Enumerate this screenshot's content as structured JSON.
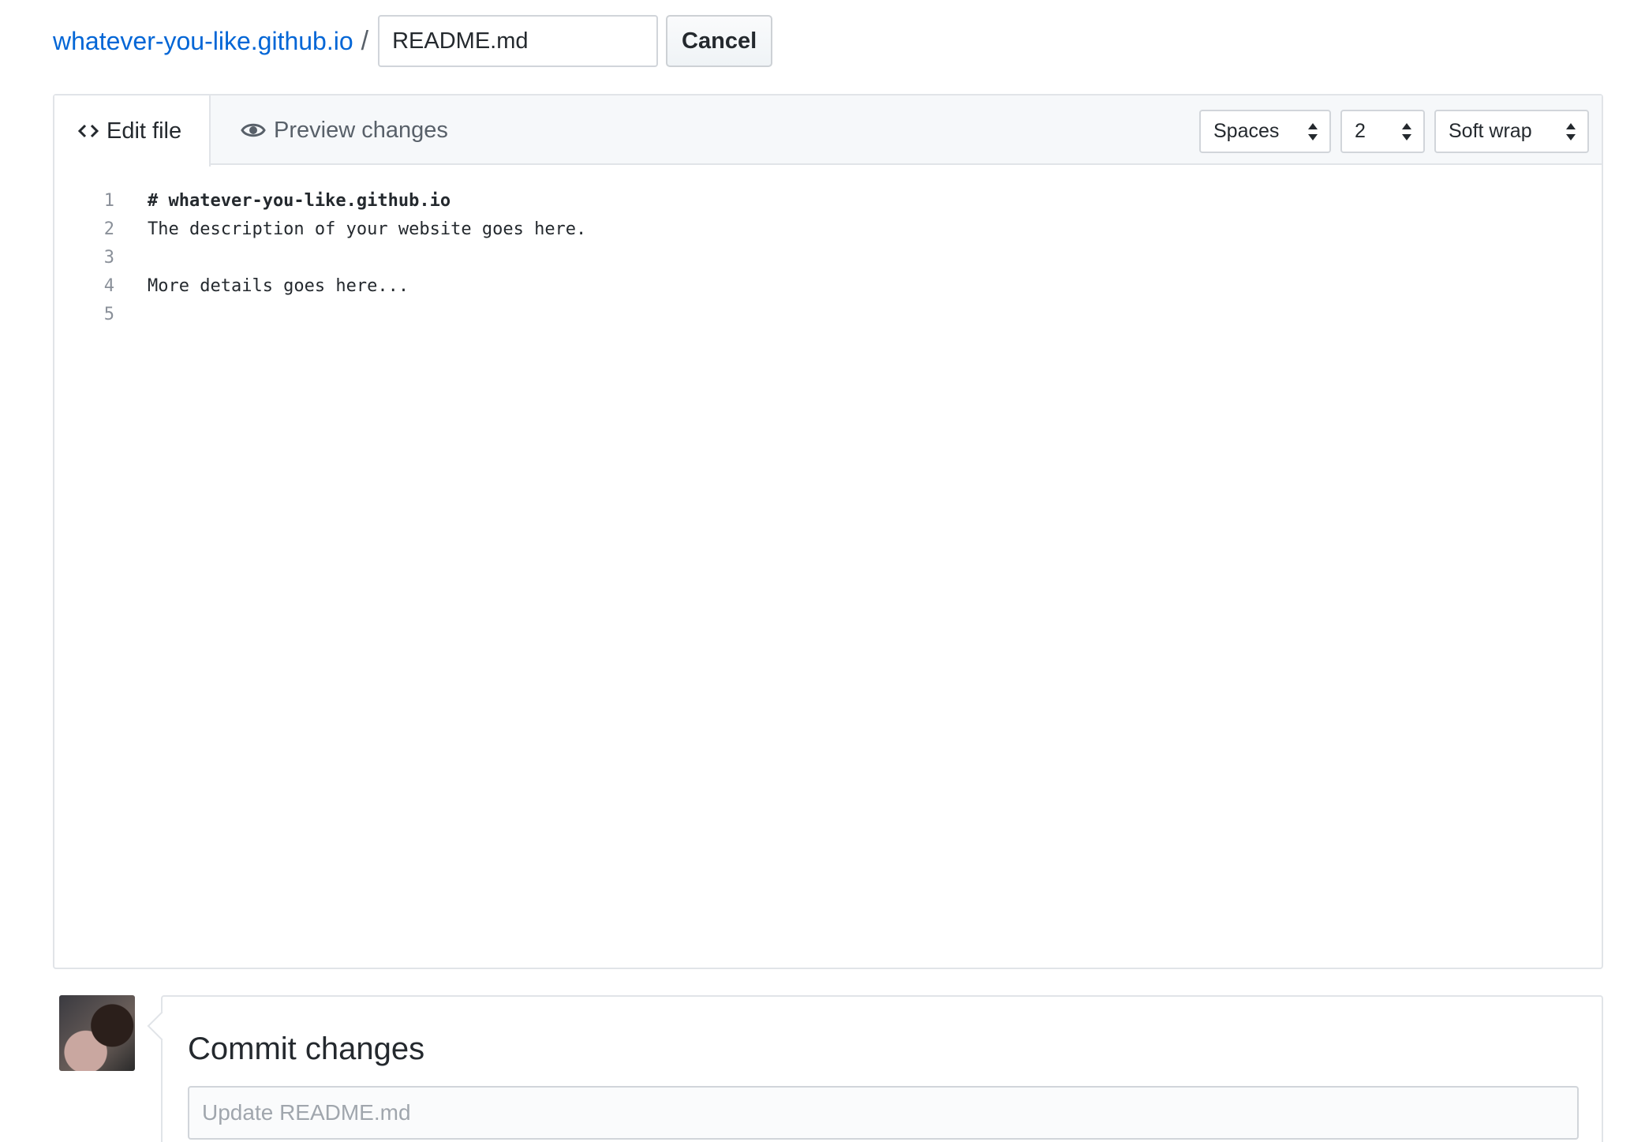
{
  "header": {
    "repo_name": "whatever-you-like.github.io",
    "separator": "/",
    "filename_value": "README.md",
    "cancel_label": "Cancel"
  },
  "editor": {
    "tabs": {
      "edit_label": "Edit file",
      "preview_label": "Preview changes"
    },
    "indent_mode": "Spaces",
    "indent_size": "2",
    "wrap_mode": "Soft wrap",
    "lines": [
      {
        "num": "1",
        "text": "# whatever-you-like.github.io"
      },
      {
        "num": "2",
        "text": "The description of your website goes here."
      },
      {
        "num": "3",
        "text": ""
      },
      {
        "num": "4",
        "text": "More details goes here..."
      },
      {
        "num": "5",
        "text": ""
      }
    ]
  },
  "commit": {
    "title": "Commit changes",
    "summary_placeholder": "Update README.md"
  },
  "colors": {
    "link": "#0366d6",
    "border": "#e1e4e8",
    "header_bg": "#f6f8fa"
  },
  "icons": [
    "code-icon",
    "eye-icon",
    "select-arrows-icon"
  ]
}
